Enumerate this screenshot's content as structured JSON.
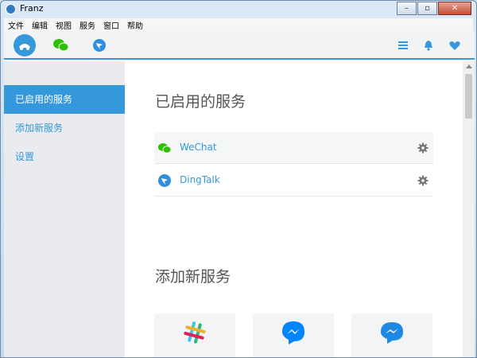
{
  "window": {
    "title": "Franz",
    "controls": {
      "minimize": "–",
      "maximize": "▫",
      "close": "✕"
    }
  },
  "menu": [
    "文件",
    "编辑",
    "视图",
    "服务",
    "窗口",
    "帮助"
  ],
  "tabs": [
    {
      "name": "franz",
      "icon": "franz-logo-icon",
      "active": true
    },
    {
      "name": "wechat",
      "icon": "wechat-icon"
    },
    {
      "name": "dingtalk",
      "icon": "dingtalk-icon"
    }
  ],
  "toolbar_icons": [
    "menu-icon",
    "bell-icon",
    "heart-icon"
  ],
  "sidebar": {
    "items": [
      {
        "label": "已启用的服务",
        "active": true
      },
      {
        "label": "添加新服务"
      },
      {
        "label": "设置"
      }
    ]
  },
  "main": {
    "enabled_title": "已启用的服务",
    "services": [
      {
        "name": "WeChat",
        "icon": "wechat-icon"
      },
      {
        "name": "DingTalk",
        "icon": "dingtalk-icon"
      }
    ],
    "add_title": "添加新服务",
    "available_services": [
      {
        "icon": "slack-icon"
      },
      {
        "icon": "messenger-icon"
      },
      {
        "icon": "messenger-alt-icon"
      }
    ]
  },
  "colors": {
    "accent": "#3498db",
    "wechat": "#2dc100",
    "sidebar": "#e9ebee"
  }
}
